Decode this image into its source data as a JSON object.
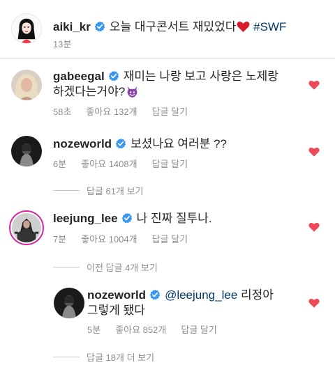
{
  "caption": {
    "username": "aiki_kr",
    "text": "오늘 대구콘서트 재밌었다",
    "hashtag": "#SWF",
    "time": "13분"
  },
  "comments": [
    {
      "username": "gabeegal",
      "text_line1": "재미는 나랑 보고 사랑은 노제랑",
      "text_line2": "하겠다는거야?",
      "emoji": "😈",
      "time": "58초",
      "likes": "좋아요 132개",
      "reply": "답글 달기"
    },
    {
      "username": "nozeworld",
      "text_line1": "보셨나요 여러분 ??",
      "time": "6분",
      "likes": "좋아요 1408개",
      "reply": "답글 달기",
      "view_replies": "답글 61개 보기"
    },
    {
      "username": "leejung_lee",
      "text_line1": "나 진짜 질투나.",
      "time": "7분",
      "likes": "좋아요 1004개",
      "reply": "답글 달기",
      "view_previous": "이전 답글 4개 보기"
    }
  ],
  "reply": {
    "username": "nozeworld",
    "mention": "@leejung_lee",
    "text_line1_rest": "리정아",
    "text_line2": "그렇게 됐다",
    "time": "5분",
    "likes": "좋아요 852개",
    "reply": "답글 달기"
  },
  "more_replies": "답글 18개 더 보기",
  "colors": {
    "verified": "#3897f0",
    "heart": "#ed4956",
    "meta": "#8e8e8e",
    "link": "#00376b"
  }
}
